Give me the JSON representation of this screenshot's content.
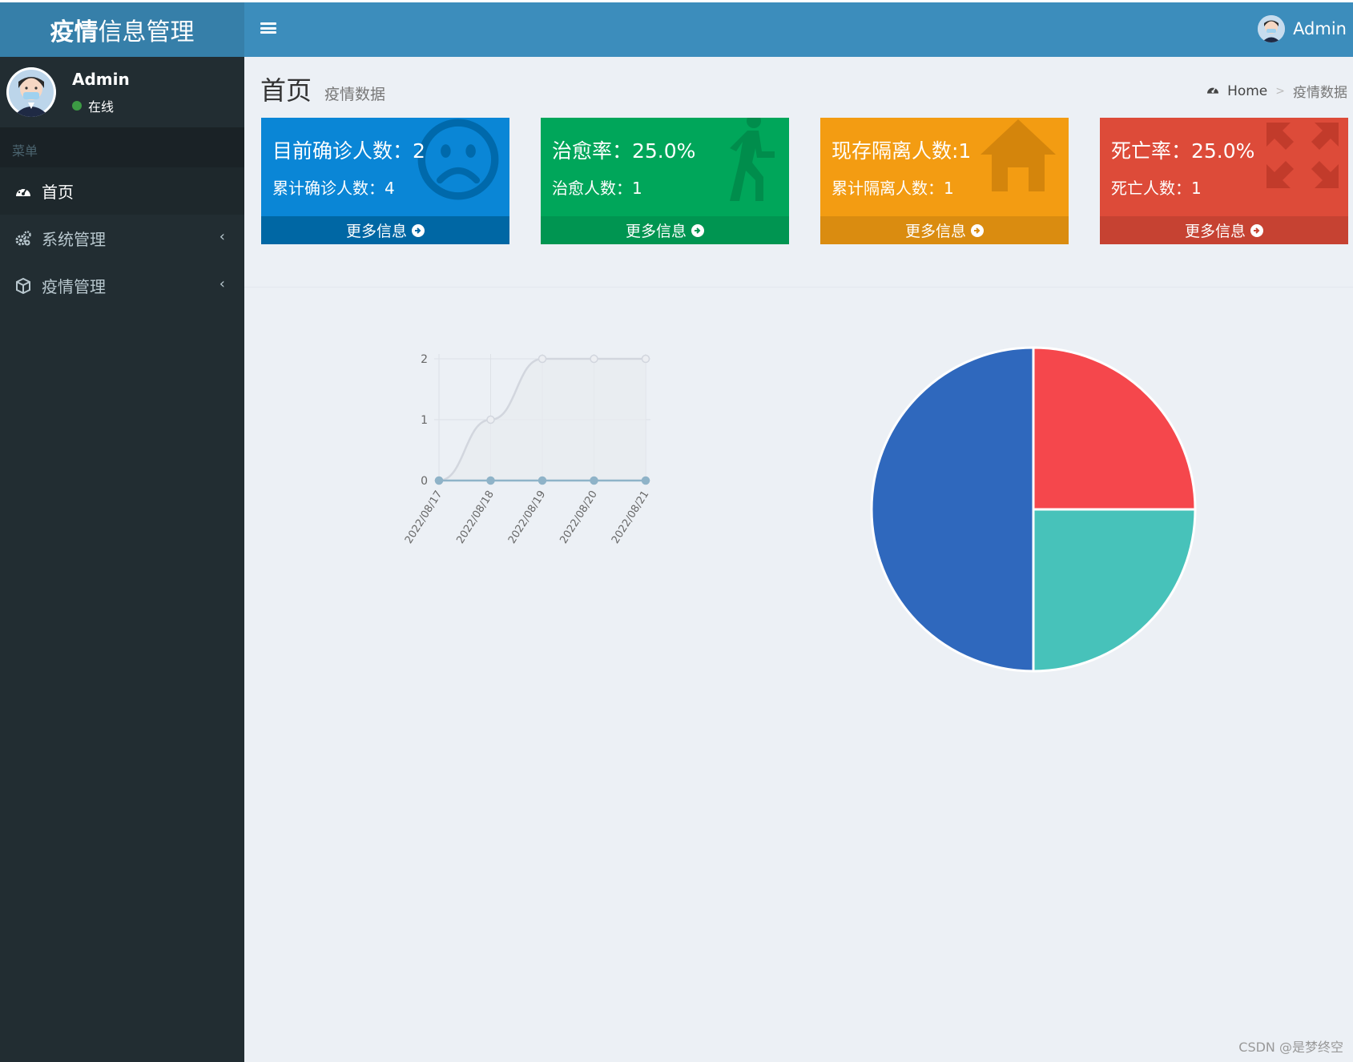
{
  "app": {
    "logo_bold": "疫情",
    "logo_rest": "信息管理"
  },
  "topnav": {
    "user_name": "Admin"
  },
  "sidebar": {
    "user_name": "Admin",
    "user_status": "在线",
    "menu_header": "菜单",
    "items": [
      {
        "label": "首页",
        "icon": "dashboard-icon"
      },
      {
        "label": "系统管理",
        "icon": "gears-icon"
      },
      {
        "label": "疫情管理",
        "icon": "cube-icon"
      }
    ]
  },
  "content": {
    "title": "首页",
    "subtitle": "疫情数据"
  },
  "breadcrumb": {
    "home": "Home",
    "current": "疫情数据"
  },
  "boxes": [
    {
      "title": "目前确诊人数：2",
      "detail": "累计确诊人数：4",
      "footer": "更多信息",
      "color": "#0073b7",
      "icon": "frown-icon"
    },
    {
      "title": "治愈率：25.0%",
      "detail": "治愈人数：1",
      "footer": "更多信息",
      "color": "#00a65a",
      "icon": "walking-person-icon"
    },
    {
      "title": "现存隔离人数:1",
      "detail": "累计隔离人数：1",
      "footer": "更多信息",
      "color": "#f39c12",
      "icon": "home-icon"
    },
    {
      "title": "死亡率：25.0%",
      "detail": "死亡人数：1",
      "footer": "更多信息",
      "color": "#dd4b39",
      "icon": "expand-icon"
    }
  ],
  "watermark": "CSDN @是梦终空",
  "chart_data": [
    {
      "type": "line",
      "x": [
        "2022/08/17",
        "2022/08/18",
        "2022/08/19",
        "2022/08/20",
        "2022/08/21"
      ],
      "series": [
        {
          "values": [
            0,
            1,
            2,
            2,
            2
          ],
          "color": "#d2d6de",
          "fill": "#e8ebf0"
        },
        {
          "values": [
            0,
            0,
            0,
            0,
            0
          ],
          "color": "#8fb3c8"
        }
      ],
      "ylim": [
        0,
        2
      ],
      "yticks": [
        0,
        1,
        2
      ],
      "grid": true
    },
    {
      "type": "pie",
      "slices": [
        {
          "value": 25,
          "color": "#f5474c"
        },
        {
          "value": 25,
          "color": "#47c2ba"
        },
        {
          "value": 50,
          "color": "#2f68bd"
        }
      ]
    }
  ]
}
